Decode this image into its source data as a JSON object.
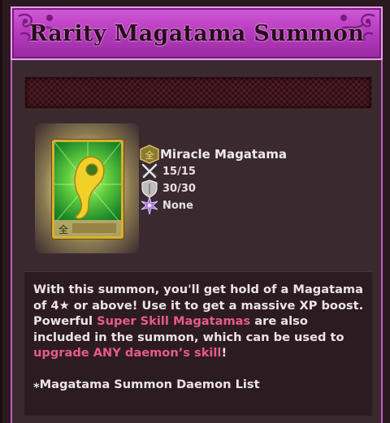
{
  "header": {
    "title": "Rarity Magatama Summon"
  },
  "item": {
    "name": "Miracle Magatama",
    "stat_1": "15/15",
    "stat_2": "30/30",
    "stat_3": "None",
    "card_glyph": "全"
  },
  "description": {
    "part1": "With this summon, you'll get hold of a Magatama of 4★ or above! Use it to get a massive XP boost. Powerful ",
    "highlight1": "Super Skill Magatamas",
    "part2": " are also included in the summon, which can be used to ",
    "highlight2": "upgrade ANY daemon’s skill",
    "part3": "!",
    "list_link": "⁎Magatama Summon Daemon List"
  },
  "colors": {
    "title_bar": "#b83cc0",
    "panel_border": "#c25ac8",
    "highlight_text": "#e85a8c",
    "card_border": "#d8b030"
  },
  "icons": {
    "type_badge": "gold-hexagon-icon",
    "attack": "crossed-swords-icon",
    "defense": "shield-icon",
    "skill": "purple-star-icon"
  }
}
